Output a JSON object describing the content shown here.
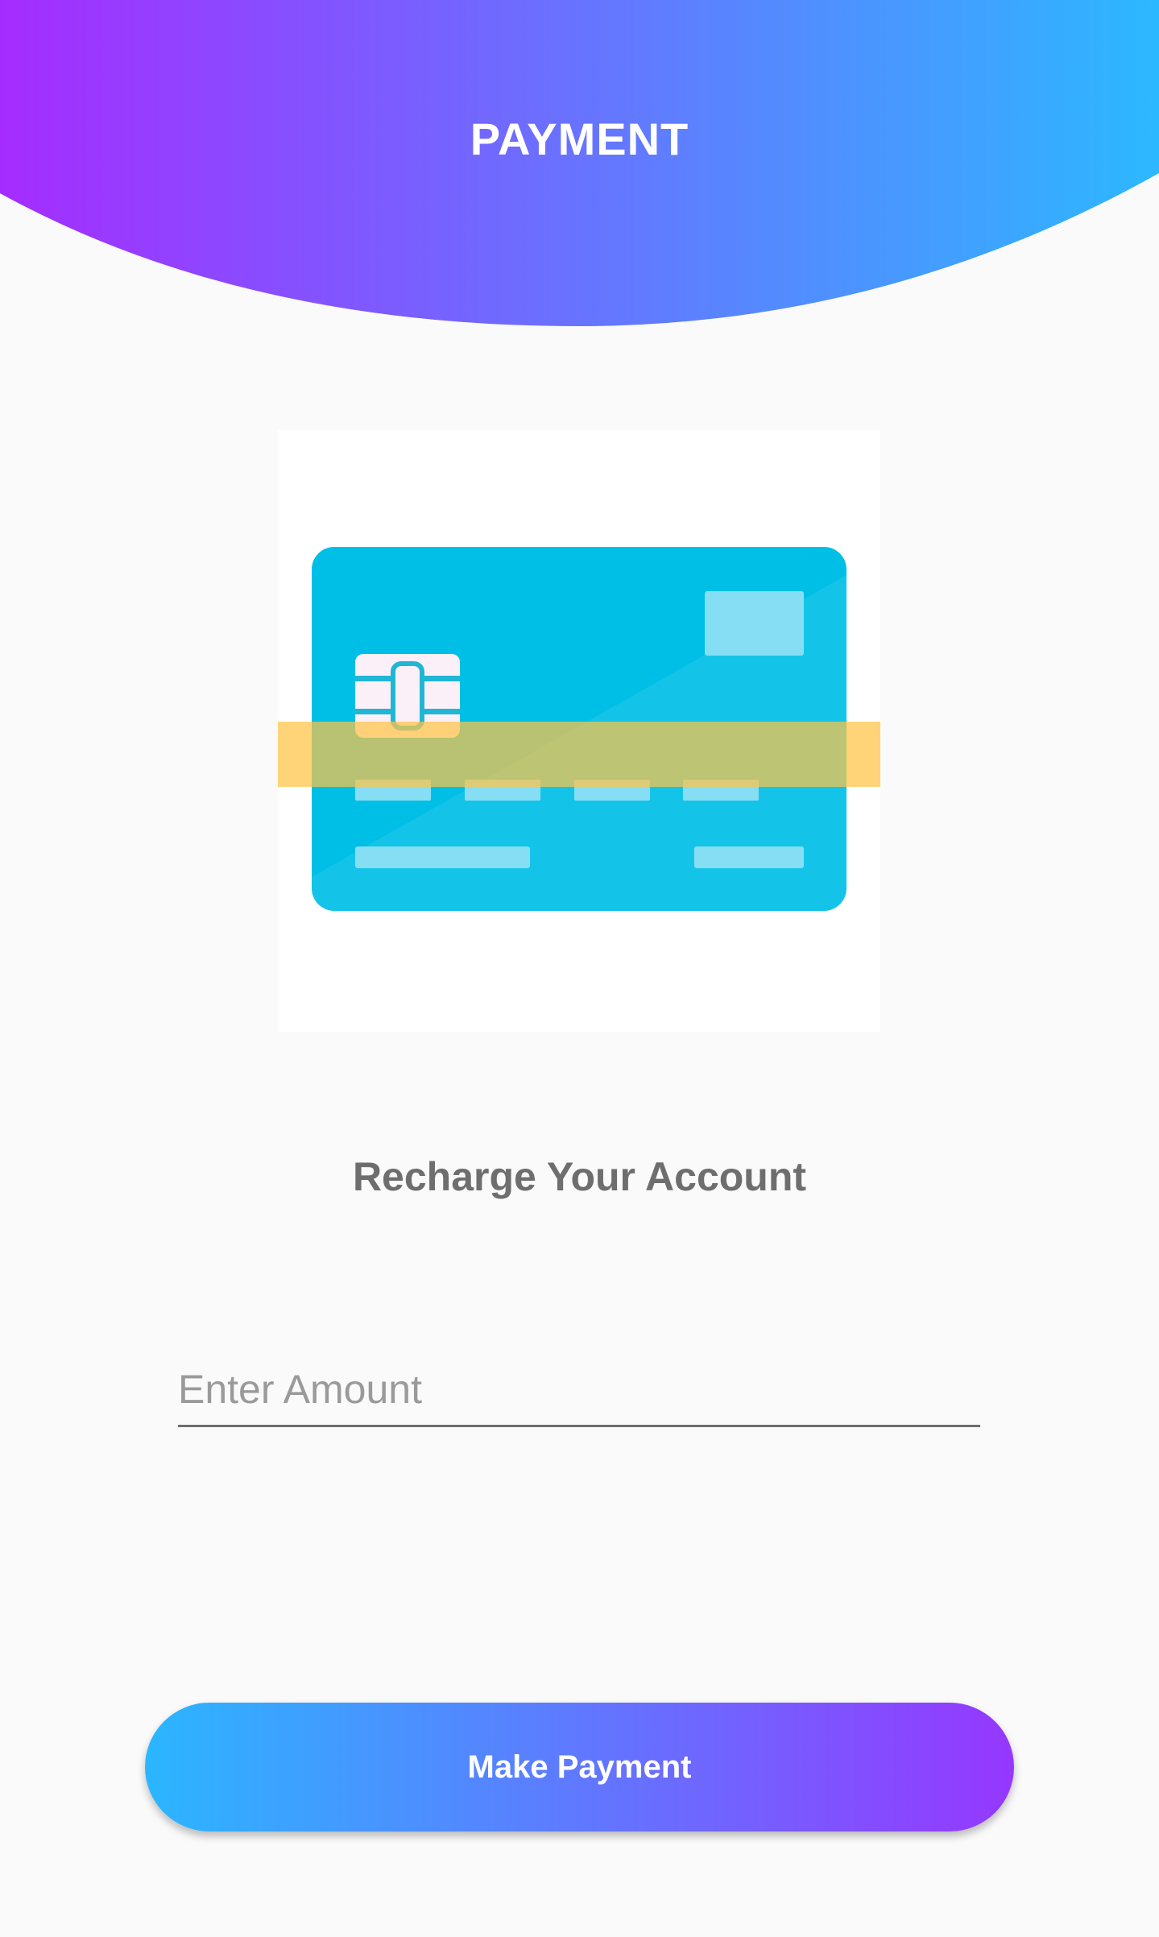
{
  "header": {
    "title": "PAYMENT",
    "gradient_start": "#a52cff",
    "gradient_end": "#2cb8ff"
  },
  "illustration": {
    "icon": "credit-card-icon",
    "card_color": "#00bfe6",
    "scan_bar_color": "#ffc445"
  },
  "main": {
    "subtitle": "Recharge Your Account"
  },
  "amount": {
    "placeholder": "Enter Amount",
    "value": ""
  },
  "actions": {
    "pay_label": "Make Payment"
  }
}
